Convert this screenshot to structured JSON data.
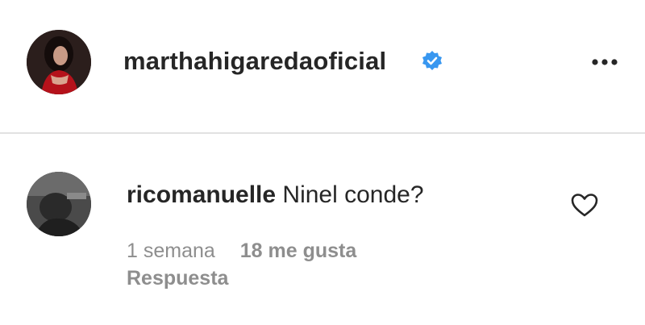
{
  "post": {
    "owner_username": "marthahigaredaoficial",
    "verified_badge_color": "#3897f0",
    "more_options_icon": "more-horizontal-icon"
  },
  "comment": {
    "username": "ricomanuelle",
    "text": "Ninel conde?",
    "time": "1 semana",
    "likes": "18 me gusta",
    "reply_label": "Respuesta",
    "like_icon": "heart-outline-icon"
  },
  "colors": {
    "text_primary": "#262626",
    "text_secondary": "#8e8e8e",
    "divider": "#e2e2e2"
  }
}
